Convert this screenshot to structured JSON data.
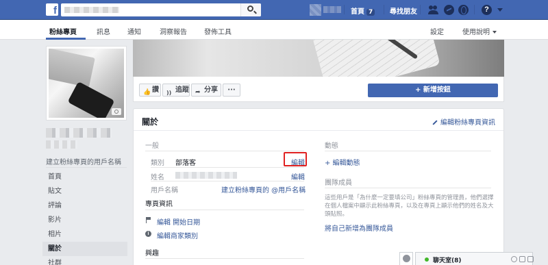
{
  "topbar": {
    "logo": "f",
    "home_label": "首頁",
    "home_badge": "7",
    "find_friends_label": "尋找朋友",
    "help_icon_glyph": "?"
  },
  "page_nav": {
    "tabs": [
      {
        "label": "粉絲專頁",
        "active": true
      },
      {
        "label": "訊息"
      },
      {
        "label": "通知"
      },
      {
        "label": "洞察報告"
      },
      {
        "label": "發佈工具"
      }
    ],
    "settings_label": "設定",
    "help_label": "使用說明"
  },
  "left": {
    "create_username": "建立粉絲專頁的用戶名稱",
    "menu": [
      "首頁",
      "貼文",
      "評論",
      "影片",
      "相片",
      "關於",
      "社群"
    ],
    "active_item": "關於"
  },
  "action_bar": {
    "like_label": "讚",
    "like_icon": "👍",
    "follow_label": "追蹤",
    "follow_icon": "rss",
    "share_label": "分享",
    "share_icon": "➦",
    "more_label": "···",
    "add_button_label": "+ 新增按鈕"
  },
  "about": {
    "title": "關於",
    "edit_page_info": "編輯粉絲專頁資訊",
    "general": {
      "heading": "一般",
      "category_label": "類別",
      "category_value": "部落客",
      "category_edit": "編輯",
      "name_label": "姓名",
      "name_edit": "編輯",
      "username_label": "用戶名稱",
      "username_link": "建立粉絲專頁的 @用戶名稱"
    },
    "page_info": {
      "heading": "專頁資訊",
      "edit_start_date": "編輯 開始日期",
      "edit_business_type": "編輯商家類別"
    },
    "story_heading": "興趣",
    "milestones": {
      "heading": "動態",
      "edit_link": "+ 編輯動態"
    },
    "team": {
      "heading": "團隊成員",
      "description": "這些用戶是「為什麼一定要填公司」粉絲專頁的管理員，他們選擇在個人檔案中顯示此粉絲專頁，以及在專頁上顯示他們的姓名及大頭貼照。",
      "add_self_link": "將自己新增為團隊成員"
    }
  },
  "chat": {
    "label": "聊天室(8)"
  },
  "colors": {
    "brand": "#4267b2",
    "link": "#365899",
    "highlight": "#e02020",
    "online": "#42b72a"
  }
}
